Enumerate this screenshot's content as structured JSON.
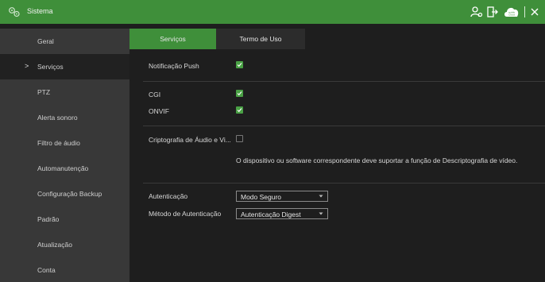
{
  "titlebar": {
    "title": "Sistema",
    "icons": [
      "app-gears-icon",
      "user-settings-icon",
      "logout-icon",
      "mobile-cloud-icon",
      "close-icon"
    ],
    "cloud_text_top": "mobile",
    "cloud_text_bottom": "Cloud"
  },
  "sidebar": {
    "items": [
      {
        "label": "Geral"
      },
      {
        "label": "Serviços",
        "active": true,
        "marker": ">"
      },
      {
        "label": "PTZ"
      },
      {
        "label": "Alerta sonoro"
      },
      {
        "label": "Filtro de áudio"
      },
      {
        "label": "Automanutenção"
      },
      {
        "label": "Configuração Backup"
      },
      {
        "label": "Padrão"
      },
      {
        "label": "Atualização"
      },
      {
        "label": "Conta"
      }
    ]
  },
  "tabs": [
    {
      "label": "Serviços",
      "active": true
    },
    {
      "label": "Termo de Uso",
      "active": false
    }
  ],
  "form": {
    "push_label": "Notificação Push",
    "push_checked": true,
    "cgi_label": "CGI",
    "cgi_checked": true,
    "onvif_label": "ONVIF",
    "onvif_checked": true,
    "crypto_label": "Criptografia de Áudio e Vi...",
    "crypto_checked": false,
    "crypto_note": "O dispositivo ou software correspondente deve suportar a função de Descriptografia de vídeo.",
    "auth_label": "Autenticação",
    "auth_value": "Modo Seguro",
    "auth_method_label": "Método de Autenticação",
    "auth_method_value": "Autenticação Digest"
  },
  "colors": {
    "accent": "#3f8f3a",
    "checkbox_on": "#4aa145",
    "background": "#1e1e1e",
    "sidebar": "#383838"
  }
}
